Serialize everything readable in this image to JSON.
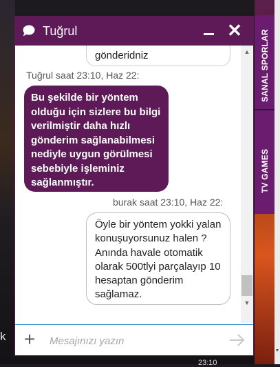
{
  "background": {
    "left_text": "k",
    "side_tabs": [
      "SANAL SPORLAR",
      "TV GAMES"
    ],
    "bottom_time": "23:10"
  },
  "chat": {
    "title": "Tuğrul",
    "minimize_icon": "minimize-icon",
    "close_icon": "close-icon",
    "messages": [
      {
        "from": "visitor",
        "text": "gönderidniz"
      },
      {
        "meta": "Tuğrul saat 23:10, Haz 22:"
      },
      {
        "from": "agent",
        "text": "Bu şekilde bir yöntem olduğu için sizlere bu bilgi verilmiştir daha hızlı gönderim sağlanabilmesi nediyle uygun görülmesi sebebiyle işleminiz sağlanmıştır."
      },
      {
        "meta": "burak saat 23:10, Haz 22:"
      },
      {
        "from": "visitor",
        "text": "Öyle bir yöntem yokki yalan konuşuyorsunuz halen ? Anında havale otomatik olarak 500tlyi parçalayıp 10 hesaptan gönderim sağlamaz."
      }
    ],
    "input": {
      "placeholder": "Mesajınızı yazın",
      "value": ""
    },
    "brand_color": "#5d1a57",
    "accent_color": "#3a8fc9"
  }
}
